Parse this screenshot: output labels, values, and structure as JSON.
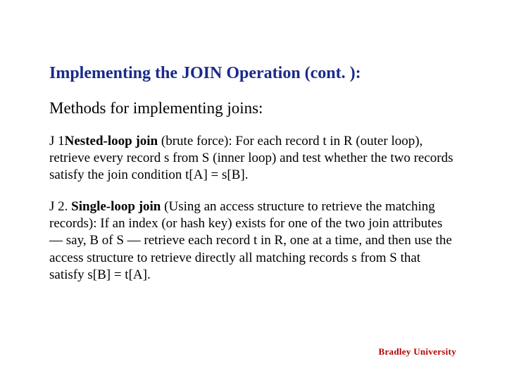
{
  "title": "Implementing the JOIN Operation (cont. ):",
  "subtitle": "Methods for implementing joins:",
  "j1": {
    "label": "J 1",
    "name": "Nested-loop join",
    "desc_a": " (brute force): For each record t in R (outer loop), retrieve every record s from S (inner loop) and test whether the two records satisfy the join condition t[A] = s[B]."
  },
  "j2": {
    "label": "J 2. ",
    "name": "Single-loop join",
    "desc_a": " (Using an access structure to retrieve the matching records): If an index (or hash key) exists for one of the two join attributes — say, B of S — retrieve each record t in R, one at a time, and then use the access structure to retrieve directly all matching records s from S that satisfy s[B] = t[A]."
  },
  "footer": "Bradley University"
}
